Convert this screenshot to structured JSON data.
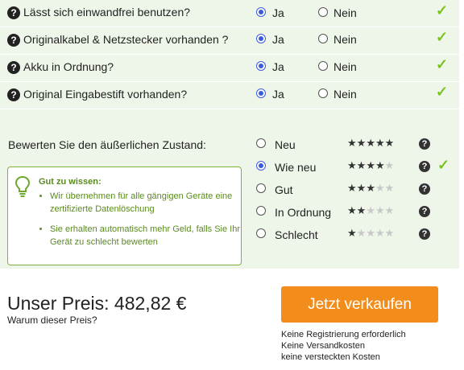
{
  "questions": [
    {
      "label": "Lässt sich einwandfrei benutzen?",
      "yes": "Ja",
      "no": "Nein",
      "selected": "yes"
    },
    {
      "label": "Originalkabel & Netzstecker vorhanden ?",
      "yes": "Ja",
      "no": "Nein",
      "selected": "yes"
    },
    {
      "label": "Akku in Ordnung?",
      "yes": "Ja",
      "no": "Nein",
      "selected": "yes"
    },
    {
      "label": "Original Eingabestift vorhanden?",
      "yes": "Ja",
      "no": "Nein",
      "selected": "yes"
    }
  ],
  "help_glyph": "?",
  "check_glyph": "✓",
  "condition": {
    "title": "Bewerten Sie den äußerlichen Zustand:",
    "options": [
      {
        "label": "Neu",
        "stars": 5,
        "selected": false
      },
      {
        "label": "Wie neu",
        "stars": 4,
        "selected": true
      },
      {
        "label": "Gut",
        "stars": 3,
        "selected": false
      },
      {
        "label": "In Ordnung",
        "stars": 2,
        "selected": false
      },
      {
        "label": "Schlecht",
        "stars": 1,
        "selected": false
      }
    ],
    "max_stars": 5
  },
  "info": {
    "title": "Gut zu wissen:",
    "items": [
      "Wir übernehmen für alle gängigen Geräte eine zertifizierte Datenlöschung",
      "Sie erhalten automatisch mehr Geld, falls Sie Ihr Gerät zu schlecht bewerten"
    ]
  },
  "price": {
    "label": "Unser Preis: 482,82 €",
    "why": "Warum dieser Preis?"
  },
  "sell_button": "Jetzt verkaufen",
  "notes": [
    "Keine Registrierung erforderlich",
    "Keine Versandkosten",
    "keine versteckten Kosten"
  ],
  "colors": {
    "accent_green": "#7cc21f",
    "button_orange": "#f28c1a",
    "panel_bg": "#eef6e9",
    "radio_blue": "#3b5bdb"
  }
}
